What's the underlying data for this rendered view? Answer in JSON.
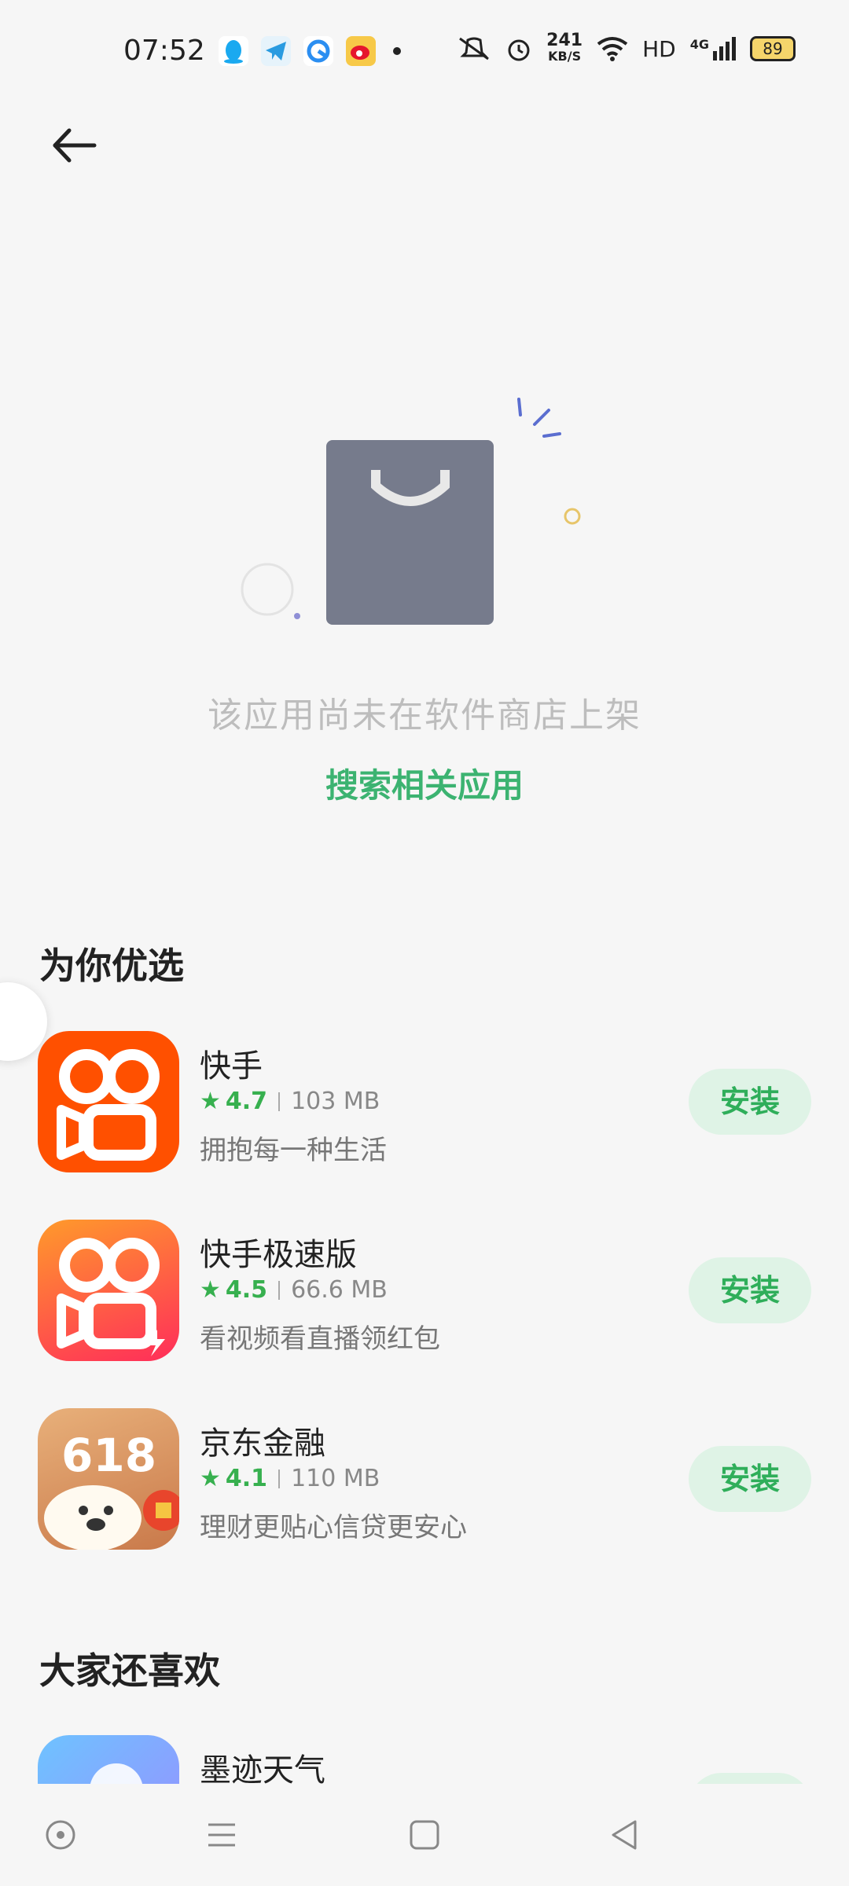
{
  "status_bar": {
    "time": "07:52",
    "net_speed_value": "241",
    "net_speed_unit": "KB/S",
    "hd_label": "HD",
    "signal_label": "4G",
    "battery": "89"
  },
  "empty_state": {
    "message": "该应用尚未在软件商店上架",
    "search_link": "搜索相关应用"
  },
  "sections": {
    "recommended_title": "为你优选",
    "also_like_title": "大家还喜欢"
  },
  "recommended_apps": [
    {
      "name": "快手",
      "rating": "4.7",
      "size": "103 MB",
      "desc": "拥抱每一种生活",
      "button": "安装",
      "icon": "kuaishou-icon"
    },
    {
      "name": "快手极速版",
      "rating": "4.5",
      "size": "66.6 MB",
      "desc": "看视频看直播领红包",
      "button": "安装",
      "icon": "kuaishou-lite-icon"
    },
    {
      "name": "京东金融",
      "rating": "4.1",
      "size": "110 MB",
      "desc": "理财更贴心信贷更安心",
      "button": "安装",
      "icon": "jd-finance-icon"
    }
  ],
  "also_like_apps": [
    {
      "name": "墨迹天气",
      "icon": "moji-weather-icon"
    }
  ],
  "icon_text": {
    "jd_618": "618"
  },
  "colors": {
    "accent_green": "#3cb371",
    "button_bg": "#dff3e6"
  }
}
